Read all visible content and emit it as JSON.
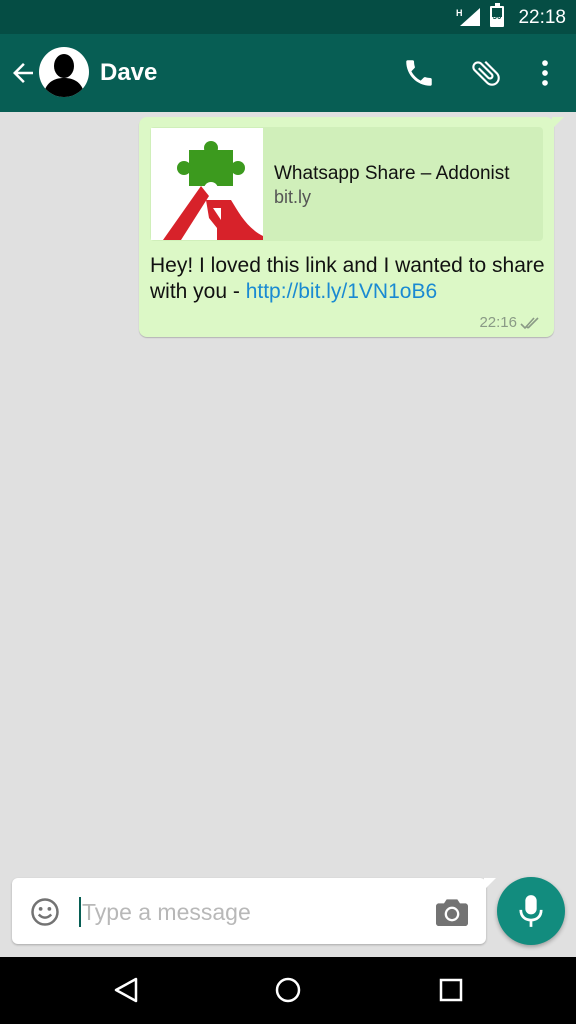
{
  "status_bar": {
    "network_type": "H",
    "battery_level": "50",
    "time": "22:18"
  },
  "header": {
    "contact_name": "Dave",
    "icons": [
      "back-arrow-icon",
      "avatar",
      "phone-icon",
      "paperclip-icon",
      "more-vert-icon"
    ]
  },
  "chat": {
    "messages": [
      {
        "direction": "outgoing",
        "link_preview": {
          "title": "Whatsapp Share – Addonist",
          "domain": "bit.ly"
        },
        "text": "Hey! I loved this link and I wanted to share with you - ",
        "link": "http://bit.ly/1VN1oB6",
        "time": "22:16",
        "status": "delivered"
      }
    ]
  },
  "composer": {
    "placeholder": "Type a message",
    "value": ""
  },
  "colors": {
    "status_bar": "#054d44",
    "app_bar": "#075e54",
    "bubble": "#dcf8c6",
    "fab": "#128c7e",
    "link": "#1a8ad2"
  }
}
